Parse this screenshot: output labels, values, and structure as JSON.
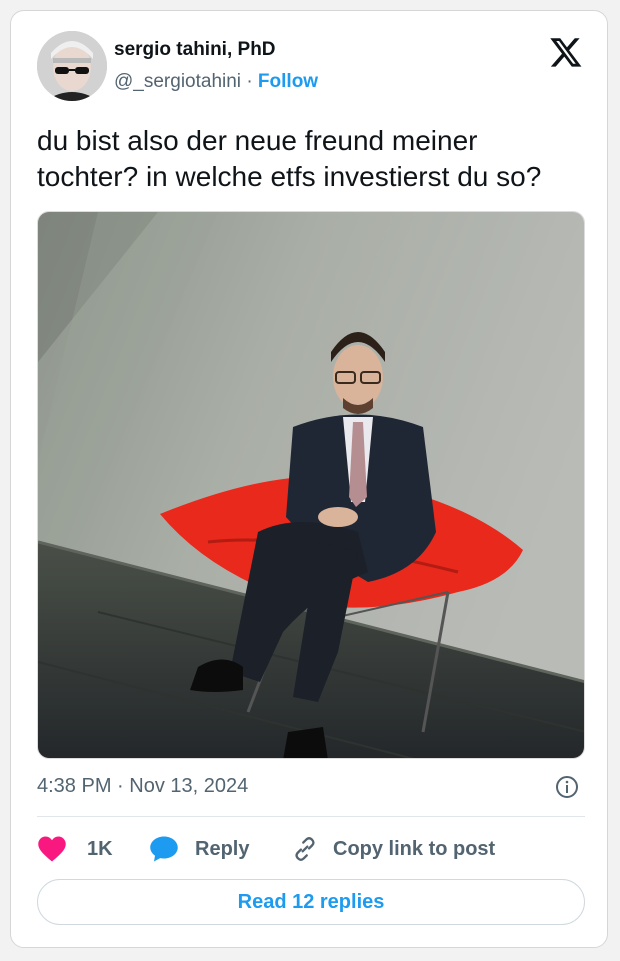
{
  "author": {
    "name": "sergio tahini, PhD",
    "handle": "@_sergiotahini",
    "separator": "·",
    "follow_label": "Follow"
  },
  "tweet": {
    "text_line1": "du bist also der neue freund meiner",
    "text_line2": "tochter? in welche etfs investierst du so?"
  },
  "meta": {
    "timestamp": "4:38 PM · Nov 13, 2024"
  },
  "actions": {
    "like_count": "1K",
    "reply_label": "Reply",
    "copy_label": "Copy link to post"
  },
  "footer": {
    "read_replies_label": "Read 12 replies"
  },
  "colors": {
    "accent": "#1d9bf0",
    "like": "#f91880",
    "chair": "#e8291c"
  }
}
